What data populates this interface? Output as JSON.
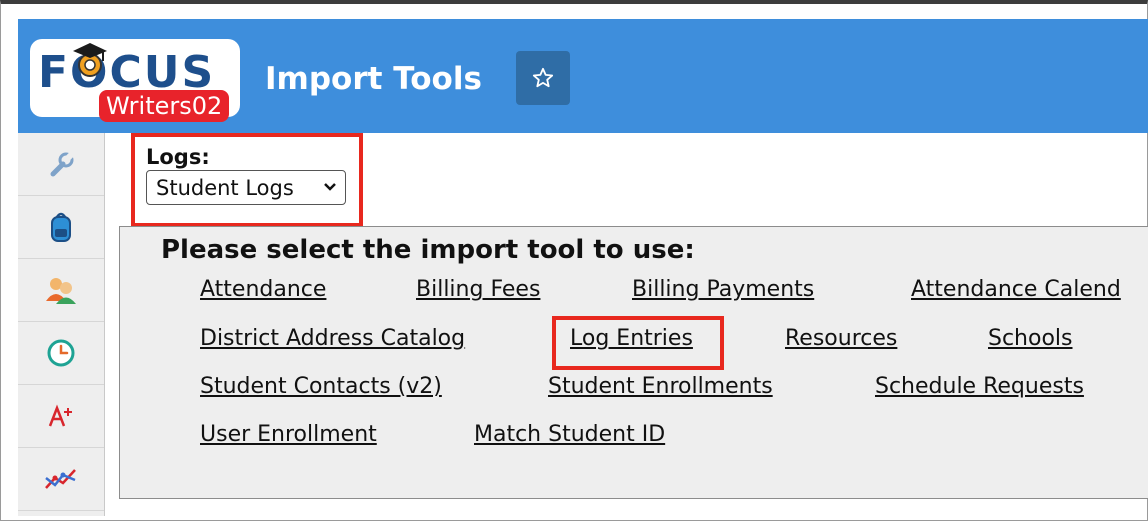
{
  "header": {
    "logo_text": "FOCUS",
    "logo_badge": "Writers02",
    "title": "Import Tools",
    "favorite_icon": "star-icon",
    "background_color": "#3e8edc"
  },
  "sidebar": {
    "items": [
      {
        "icon": "wrench-icon"
      },
      {
        "icon": "backpack-icon"
      },
      {
        "icon": "users-icon"
      },
      {
        "icon": "clock-icon"
      },
      {
        "icon": "grade-a-plus-icon"
      },
      {
        "icon": "line-chart-icon"
      }
    ]
  },
  "logs": {
    "label": "Logs:",
    "selected": "Student Logs"
  },
  "tools": {
    "prompt": "Please select the import tool to use:",
    "links": [
      "Attendance",
      "Billing Fees",
      "Billing Payments",
      "Attendance Calend",
      "District Address Catalog",
      "Log Entries",
      "Resources",
      "Schools",
      "Student Contacts (v2)",
      "Student Enrollments",
      "Schedule Requests",
      "User Enrollment",
      "Match Student ID"
    ]
  },
  "colors": {
    "highlight": "#e8281e",
    "panel": "#eeeeee",
    "sidebar": "#eeeeee"
  }
}
